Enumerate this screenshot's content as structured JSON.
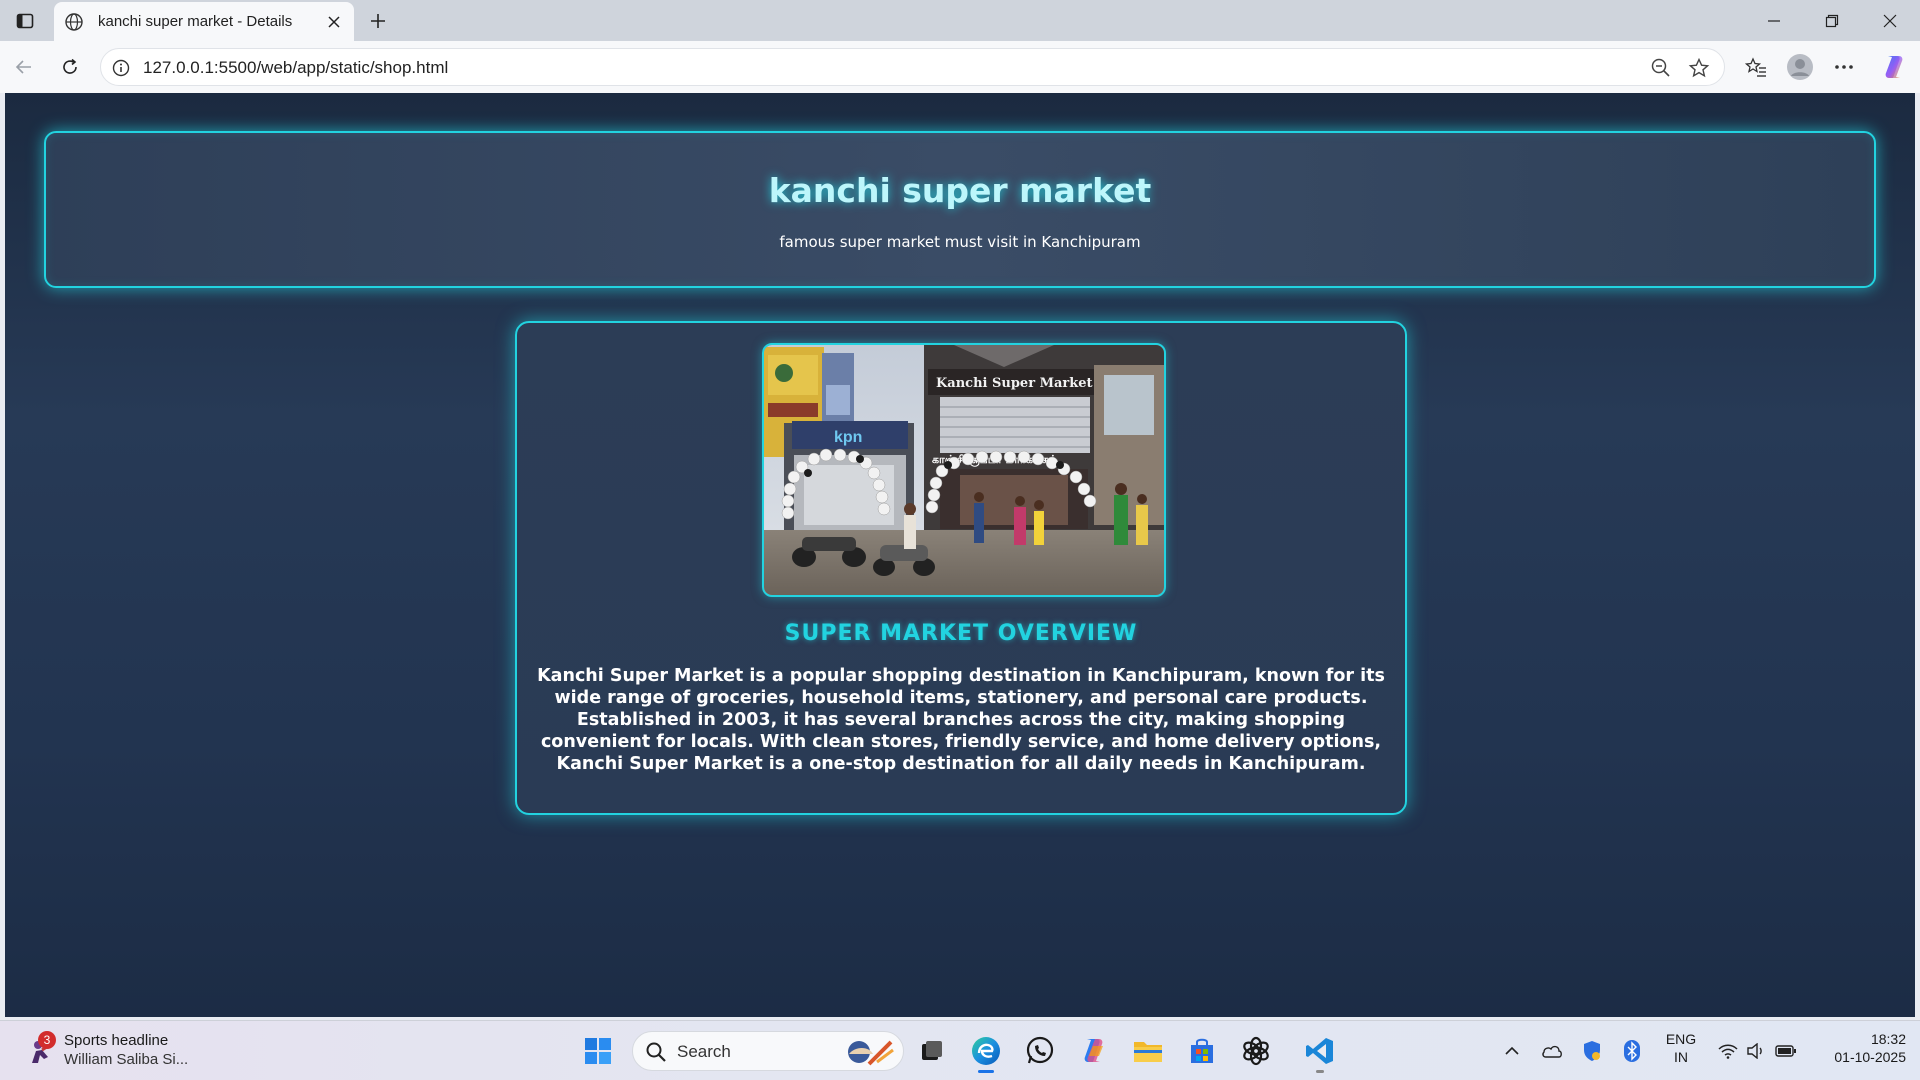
{
  "browser": {
    "tab_title": "kanchi super market - Details",
    "url": "127.0.0.1:5500/web/app/static/shop.html",
    "icons": [
      "tab-actions-icon",
      "globe-icon",
      "close-icon",
      "plus-icon",
      "back-icon",
      "refresh-icon",
      "info-icon",
      "zoom-out-icon",
      "star-icon",
      "favorites-icon",
      "profile-icon",
      "more-icon",
      "copilot-icon",
      "minimize-icon",
      "restore-icon",
      "close-window-icon"
    ]
  },
  "page": {
    "header": {
      "title": "kanchi super market",
      "subtitle": "famous super market must visit in Kanchipuram"
    },
    "photo": {
      "sign_text": "Kanchi Super Market",
      "sign_tamil": "காஞ்சி சூப்பர் மார்க்கெட்",
      "neighbor_sign": "kpn"
    },
    "overview_heading": "SUPER MARKET OVERVIEW",
    "overview_text": "Kanchi Super Market is a popular shopping destination in Kanchipuram, known for its wide range of groceries, household items, stationery, and personal care products. Established in 2003, it has several branches across the city, making shopping convenient for locals. With clean stores, friendly service, and home delivery options, Kanchi Super Market is a one-stop destination for all daily needs in Kanchipuram.",
    "colors": {
      "accent": "#22d3e0",
      "background": "#223450",
      "card": "#2c3d56"
    }
  },
  "taskbar": {
    "news_badge": "3",
    "news_line1": "Sports headline",
    "news_line2": "William Saliba Si...",
    "search_placeholder": "Search",
    "lang_line1": "ENG",
    "lang_line2": "IN",
    "time": "18:32",
    "date": "01-10-2025"
  }
}
